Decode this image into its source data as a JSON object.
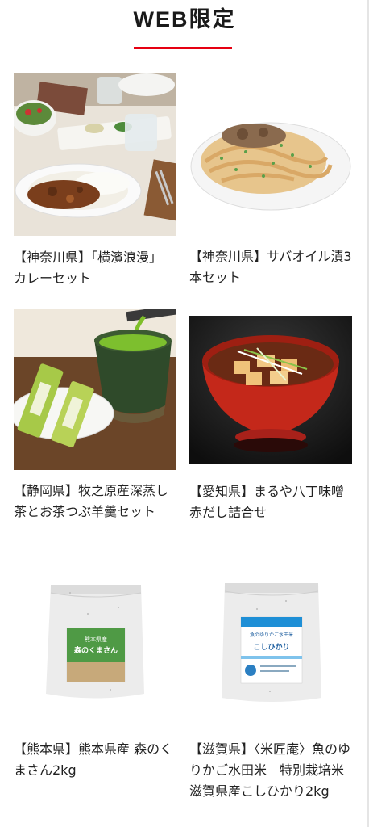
{
  "section": {
    "title": "WEB限定"
  },
  "products": [
    {
      "label": "【神奈川県】「横濱浪漫」 カレーセット",
      "image_icon": "curry-plate-image"
    },
    {
      "label": "【神奈川県】サバオイル漬3本セット",
      "image_icon": "pasta-plate-image"
    },
    {
      "label": "【静岡県】牧之原産深蒸し茶とお茶つぶ羊羹セット",
      "image_icon": "green-tea-cup-image"
    },
    {
      "label": "【愛知県】まるや八丁味噌　赤だし詰合せ",
      "image_icon": "miso-soup-bowl-image"
    },
    {
      "label": "【熊本県】熊本県産 森のくまさん2kg",
      "image_icon": "rice-bag-green-image"
    },
    {
      "label": "【滋賀県】〈米匠庵〉魚のゆりかご水田米　特別栽培米 滋賀県産こしひかり2kg",
      "image_icon": "rice-bag-blue-image"
    }
  ],
  "packaging": {
    "bag1_line1": "熊本県産",
    "bag1_line2": "森のくまさん",
    "bag2_line1": "魚のゆりかご水田米",
    "bag2_line2": "こしひかり"
  }
}
